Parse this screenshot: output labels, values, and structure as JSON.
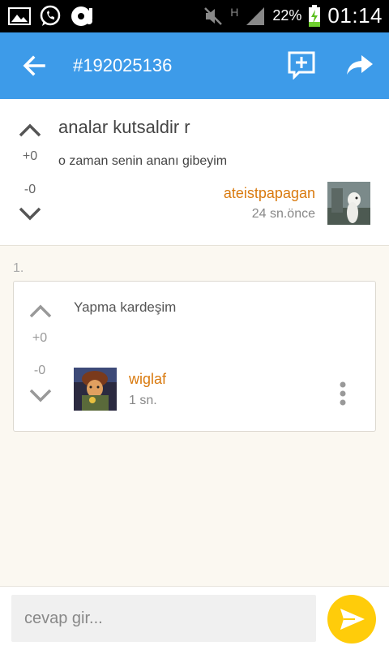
{
  "status_bar": {
    "battery": "22%",
    "time": "01:14",
    "network": "H"
  },
  "app_bar": {
    "title": "#192025136",
    "icons": [
      "back-arrow-icon",
      "add-comment-icon",
      "share-icon"
    ]
  },
  "post": {
    "title": "analar kutsaldir r",
    "body": "o zaman senin ananı gibeyim",
    "upvotes": "+0",
    "downvotes": "-0",
    "author": "ateistpapagan",
    "time_ago": "24 sn.önce"
  },
  "comments": [
    {
      "number": "1.",
      "text": "Yapma kardeşim",
      "upvotes": "+0",
      "downvotes": "-0",
      "author": "wiglaf",
      "time_ago": "1 sn."
    }
  ],
  "composer": {
    "placeholder": "cevap gir..."
  },
  "colors": {
    "app_bar": "#3d9be9",
    "username": "#d97a0f",
    "send_button": "#ffcc0a",
    "background": "#fbf8f1"
  }
}
